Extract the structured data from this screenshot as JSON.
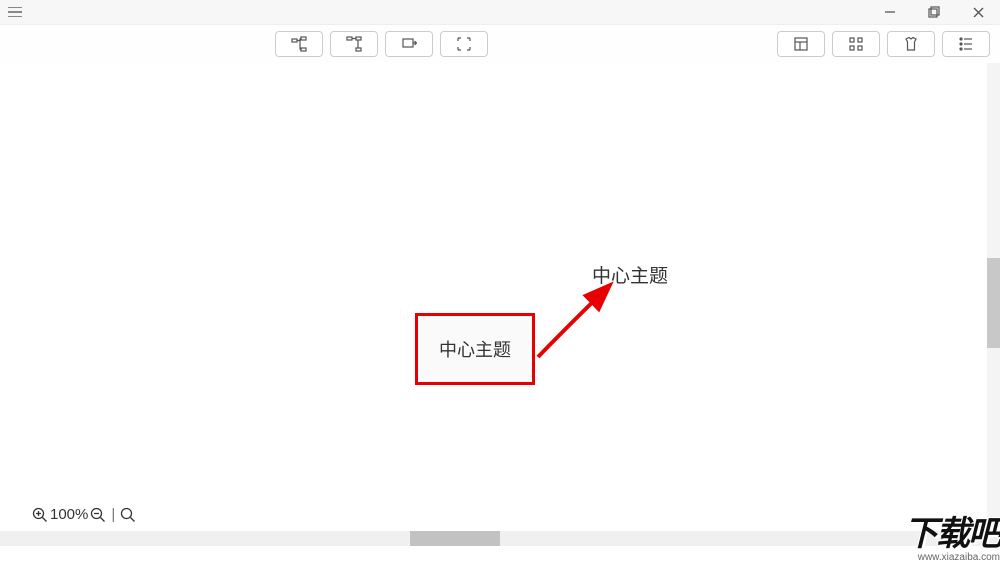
{
  "toolbar": {
    "center": [
      "insert-child",
      "insert-sibling",
      "insert-float",
      "expand-collapse"
    ],
    "right": [
      "grid-view",
      "app-view",
      "theme",
      "outline"
    ]
  },
  "canvas": {
    "center_topic_label": "中心主题",
    "floating_topic_label": "中心主题"
  },
  "zoom": {
    "level": "100%",
    "divider": "|"
  },
  "watermark": {
    "logo": "下载吧",
    "url": "www.xiazaiba.com"
  }
}
